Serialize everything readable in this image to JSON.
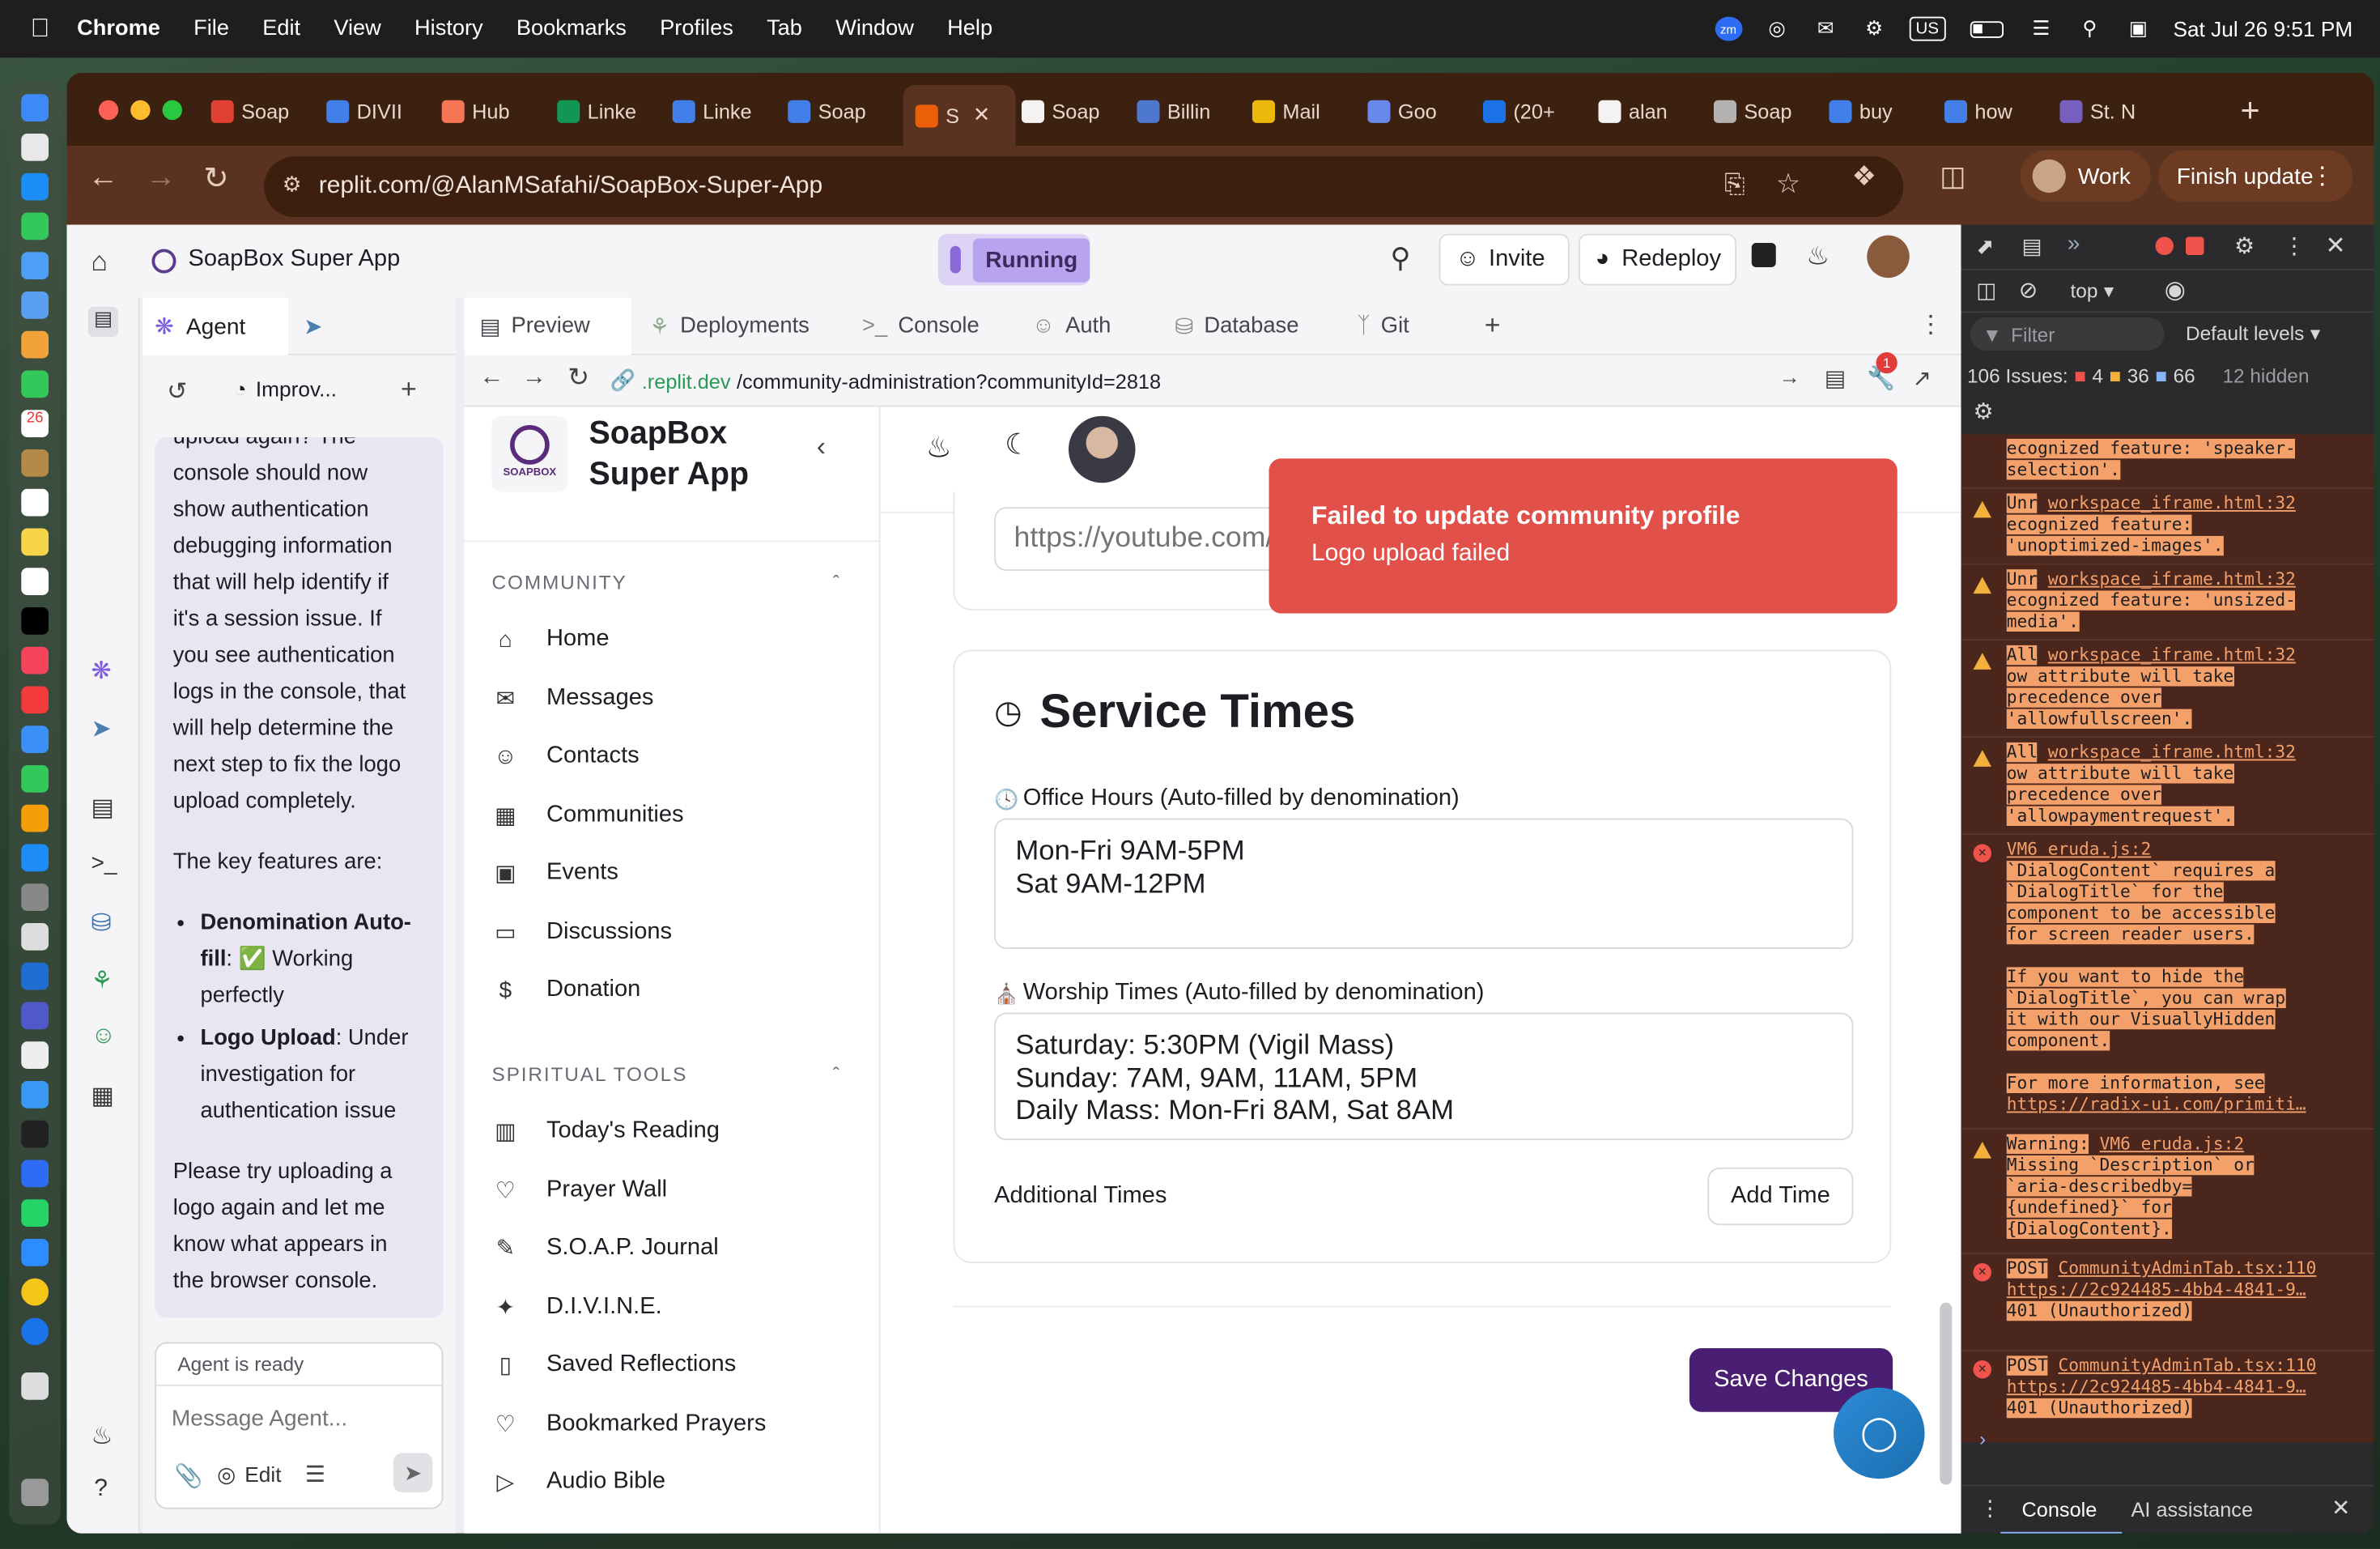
{
  "menubar": {
    "app": "Chrome",
    "items": [
      "File",
      "Edit",
      "View",
      "History",
      "Bookmarks",
      "Profiles",
      "Tab",
      "Window",
      "Help"
    ],
    "datetime": "Sat Jul 26  9:51 PM",
    "input_source": "US",
    "zoom_badge": "zm"
  },
  "browser": {
    "tabs": [
      {
        "label": "Soap",
        "icon": "gmail-icon",
        "color": "#ea4335"
      },
      {
        "label": "DIVII",
        "icon": "docs-icon",
        "color": "#4285f4"
      },
      {
        "label": "Hub",
        "icon": "hubspot-icon",
        "color": "#ff7a59"
      },
      {
        "label": "Linke",
        "icon": "sheets-icon",
        "color": "#0f9d58"
      },
      {
        "label": "Linke",
        "icon": "docs-icon",
        "color": "#4285f4"
      },
      {
        "label": "Soap",
        "icon": "docs-icon",
        "color": "#4285f4"
      },
      {
        "label": "S",
        "icon": "replit-icon",
        "color": "#f26207"
      },
      {
        "label": "Soap",
        "icon": "openai-icon",
        "color": "#ffffff"
      },
      {
        "label": "Billin",
        "icon": "billing-icon",
        "color": "#4f7dd8"
      },
      {
        "label": "Mail",
        "icon": "mail-icon",
        "color": "#f4c20d"
      },
      {
        "label": "Goo",
        "icon": "gemini-icon",
        "color": "#6c8ef5"
      },
      {
        "label": "(20+",
        "icon": "facebook-icon",
        "color": "#1877f2"
      },
      {
        "label": "alan",
        "icon": "github-icon",
        "color": "#ffffff"
      },
      {
        "label": "Soap",
        "icon": "globe-icon",
        "color": "#bbbbbb"
      },
      {
        "label": "buy",
        "icon": "google-icon",
        "color": "#4285f4"
      },
      {
        "label": "how",
        "icon": "google-icon",
        "color": "#4285f4"
      },
      {
        "label": "St. N",
        "icon": "church-icon",
        "color": "#7a63c9"
      }
    ],
    "url": "replit.com/@AlanMSafahi/SoapBox-Super-App",
    "profile_label": "Work",
    "update_label": "Finish update"
  },
  "replit": {
    "app_name": "SoapBox Super App",
    "status": "Running",
    "invite": "Invite",
    "redeploy": "Redeploy",
    "agent_tab": "Agent",
    "improve_label": "Improv...",
    "chat": {
      "p1_lines": [
        "upload again? The",
        "console should now",
        "show authentication",
        "debugging information",
        "that will help identify if",
        "it's a session issue. If",
        "you see authentication",
        "logs in the console, that",
        "will help determine the",
        "next step to fix the logo",
        "upload completely."
      ],
      "p2": "The key features are:",
      "b1_bold_1": "Denomination Auto-",
      "b1_bold_2": "fill",
      "b1_rest_1": ": ✅ Working",
      "b1_rest_2": "perfectly",
      "b2_bold": "Logo Upload",
      "b2_rest_1": ": Under",
      "b2_rest_2": "investigation for",
      "b2_rest_3": "authentication issue",
      "p3_lines": [
        "Please try uploading a",
        "logo again and let me",
        "know what appears in",
        "the browser console."
      ]
    },
    "agent_status": "Agent is ready",
    "message_placeholder": "Message Agent...",
    "edit_label": "Edit",
    "panel_tabs": [
      "Preview",
      "Deployments",
      "Console",
      "Auth",
      "Database",
      "Git"
    ],
    "preview_url_host": ".replit.dev",
    "preview_url_path": "/community-administration?communityId=2818",
    "preview_badge": "1"
  },
  "app": {
    "brand_line1": "SoapBox",
    "brand_line2": "Super App",
    "logo_text": "SOAPBOX",
    "community_heading": "COMMUNITY",
    "community_items": [
      {
        "label": "Home",
        "icon": "home-icon"
      },
      {
        "label": "Messages",
        "icon": "mail-icon"
      },
      {
        "label": "Contacts",
        "icon": "user-plus-icon"
      },
      {
        "label": "Communities",
        "icon": "building-icon"
      },
      {
        "label": "Events",
        "icon": "calendar-icon"
      },
      {
        "label": "Discussions",
        "icon": "chat-icon"
      },
      {
        "label": "Donation",
        "icon": "dollar-icon"
      }
    ],
    "tools_heading": "SPIRITUAL TOOLS",
    "tools_items": [
      {
        "label": "Today's Reading",
        "icon": "book-icon"
      },
      {
        "label": "Prayer Wall",
        "icon": "heart-icon"
      },
      {
        "label": "S.O.A.P. Journal",
        "icon": "pen-icon"
      },
      {
        "label": "D.I.V.I.N.E.",
        "icon": "sparkle-icon"
      },
      {
        "label": "Saved Reflections",
        "icon": "bookmark-icon"
      },
      {
        "label": "Bookmarked Prayers",
        "icon": "heart-icon"
      },
      {
        "label": "Audio Bible",
        "icon": "play-icon"
      }
    ],
    "youtube_placeholder": "https://youtube.com/",
    "service_title": "Service Times",
    "office_label": "Office Hours (Auto-filled by denomination)",
    "office_value": "Mon-Fri 9AM-5PM\nSat 9AM-12PM",
    "worship_label": "Worship Times (Auto-filled by denomination)",
    "worship_value": "Saturday: 5:30PM (Vigil Mass)\nSunday: 7AM, 9AM, 11AM, 5PM\nDaily Mass: Mon-Fri 8AM, Sat 8AM",
    "additional_label": "Additional Times",
    "add_time": "Add Time",
    "save": "Save Changes",
    "toast_title": "Failed to update community profile",
    "toast_body": "Logo upload failed",
    "toast_color": "#e2504a",
    "save_color": "#4a1f73"
  },
  "devtools": {
    "context": "top",
    "filter_placeholder": "Filter",
    "levels": "Default levels",
    "issues_label": "106 Issues:",
    "issue_err": "4",
    "issue_warn": "36",
    "issue_info": "66",
    "hidden": "12 hidden",
    "err_badge": "",
    "console_tab": "Console",
    "ai_tab": "AI assistance",
    "entries": [
      {
        "lines": [
          "ecognized feature: 'speaker-",
          "selection'."
        ]
      },
      {
        "link": "workspace_iframe.html:32",
        "prefix": "Unr",
        "lines": [
          "ecognized feature:",
          "'unoptimized-images'."
        ]
      },
      {
        "link": "workspace_iframe.html:32",
        "prefix": "Unr",
        "lines": [
          "ecognized feature: 'unsized-",
          "media'."
        ]
      },
      {
        "link": "workspace_iframe.html:32",
        "prefix": "All",
        "lines": [
          "ow attribute will take",
          "precedence over",
          "'allowfullscreen'."
        ]
      },
      {
        "link": "workspace_iframe.html:32",
        "prefix": "All",
        "lines": [
          "ow attribute will take",
          "precedence over",
          "'allowpaymentrequest'."
        ]
      },
      {
        "link": "VM6 eruda.js:2",
        "lines": [
          "`DialogContent` requires a",
          "`DialogTitle` for the",
          "component to be accessible",
          "for screen reader users.",
          "",
          "If you want to hide the",
          "`DialogTitle`, you can wrap",
          "it with our VisuallyHidden",
          "component.",
          "",
          "For more information, see"
        ],
        "url": "https://radix-ui.com/primiti…"
      },
      {
        "link": "VM6 eruda.js:2",
        "prefix": "Warning:",
        "lines": [
          "Missing `Description` or",
          "`aria-describedby=",
          "{undefined}` for",
          "{DialogContent}."
        ]
      },
      {
        "prefix": "POST",
        "link": "CommunityAdminTab.tsx:110",
        "url": "https://2c924485-4bb4-4841-9…",
        "lines": [
          "401 (Unauthorized)"
        ]
      },
      {
        "prefix": "POST",
        "link": "CommunityAdminTab.tsx:110",
        "url": "https://2c924485-4bb4-4841-9…",
        "lines": [
          "401 (Unauthorized)"
        ]
      }
    ]
  }
}
